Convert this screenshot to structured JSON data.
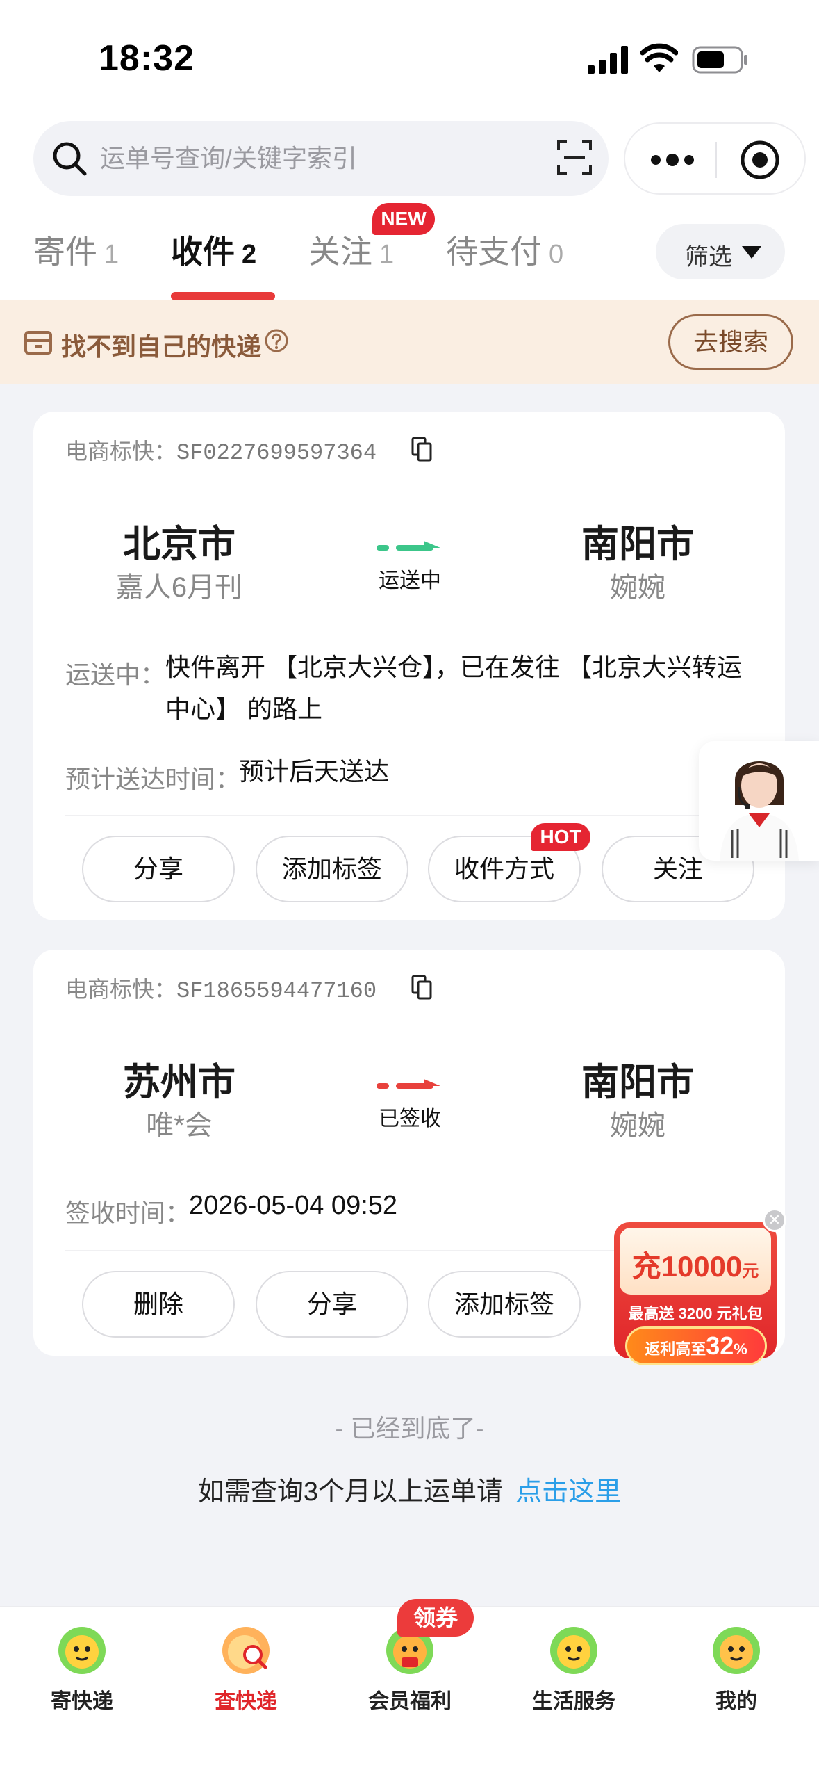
{
  "status_bar": {
    "time": "18:32"
  },
  "search": {
    "placeholder": "运单号查询/关键字索引"
  },
  "tabs": [
    {
      "label": "寄件",
      "count": "1"
    },
    {
      "label": "收件",
      "count": "2"
    },
    {
      "label": "关注",
      "count": "1",
      "badge": "NEW"
    },
    {
      "label": "待支付",
      "count": "0"
    }
  ],
  "filter_label": "筛选",
  "notice": {
    "text": "找不到自己的快递",
    "button": "去搜索"
  },
  "shipments": [
    {
      "waybill_label": "电商标快：",
      "waybill_no": "SF0227699597364",
      "from_city": "北京市",
      "from_sender": "嘉人6月刊",
      "status": "运送中",
      "to_city": "南阳市",
      "to_receiver": "婉婉",
      "detail_label": "运送中：",
      "detail_line1": "快件离开 【北京大兴仓】，已在发往 【北京大兴转运",
      "detail_line2": "中心】 的路上",
      "eta_label": "预计送达时间：",
      "eta_value": "预计后天送达",
      "actions": [
        "分享",
        "添加标签",
        "收件方式",
        "关注"
      ],
      "hot_badge": "HOT",
      "arrow_color": "#3cc68a"
    },
    {
      "waybill_label": "电商标快：",
      "waybill_no": "SF1865594477160",
      "from_city": "苏州市",
      "from_sender": "唯*会",
      "status": "已签收",
      "to_city": "南阳市",
      "to_receiver": "婉婉",
      "signed_label": "签收时间：",
      "signed_value": "2026-05-04 09:52",
      "actions": [
        "删除",
        "分享",
        "添加标签"
      ],
      "arrow_color": "#e8413c"
    }
  ],
  "promo": {
    "amount": "充10000",
    "unit": "元",
    "gift": "最高送 3200 元礼包",
    "rebate_prefix": "返利高至",
    "rebate_value": "32",
    "rebate_unit": "%"
  },
  "end_text": "- 已经到底了-",
  "more_query": {
    "text": "如需查询3个月以上运单请",
    "link": "点击这里"
  },
  "bottom_nav": [
    {
      "label": "寄快递",
      "active": false
    },
    {
      "label": "查快递",
      "active": true
    },
    {
      "label": "会员福利",
      "active": false
    },
    {
      "label": "生活服务",
      "active": false
    },
    {
      "label": "我的",
      "active": false
    }
  ],
  "coupon_badge": "领券"
}
